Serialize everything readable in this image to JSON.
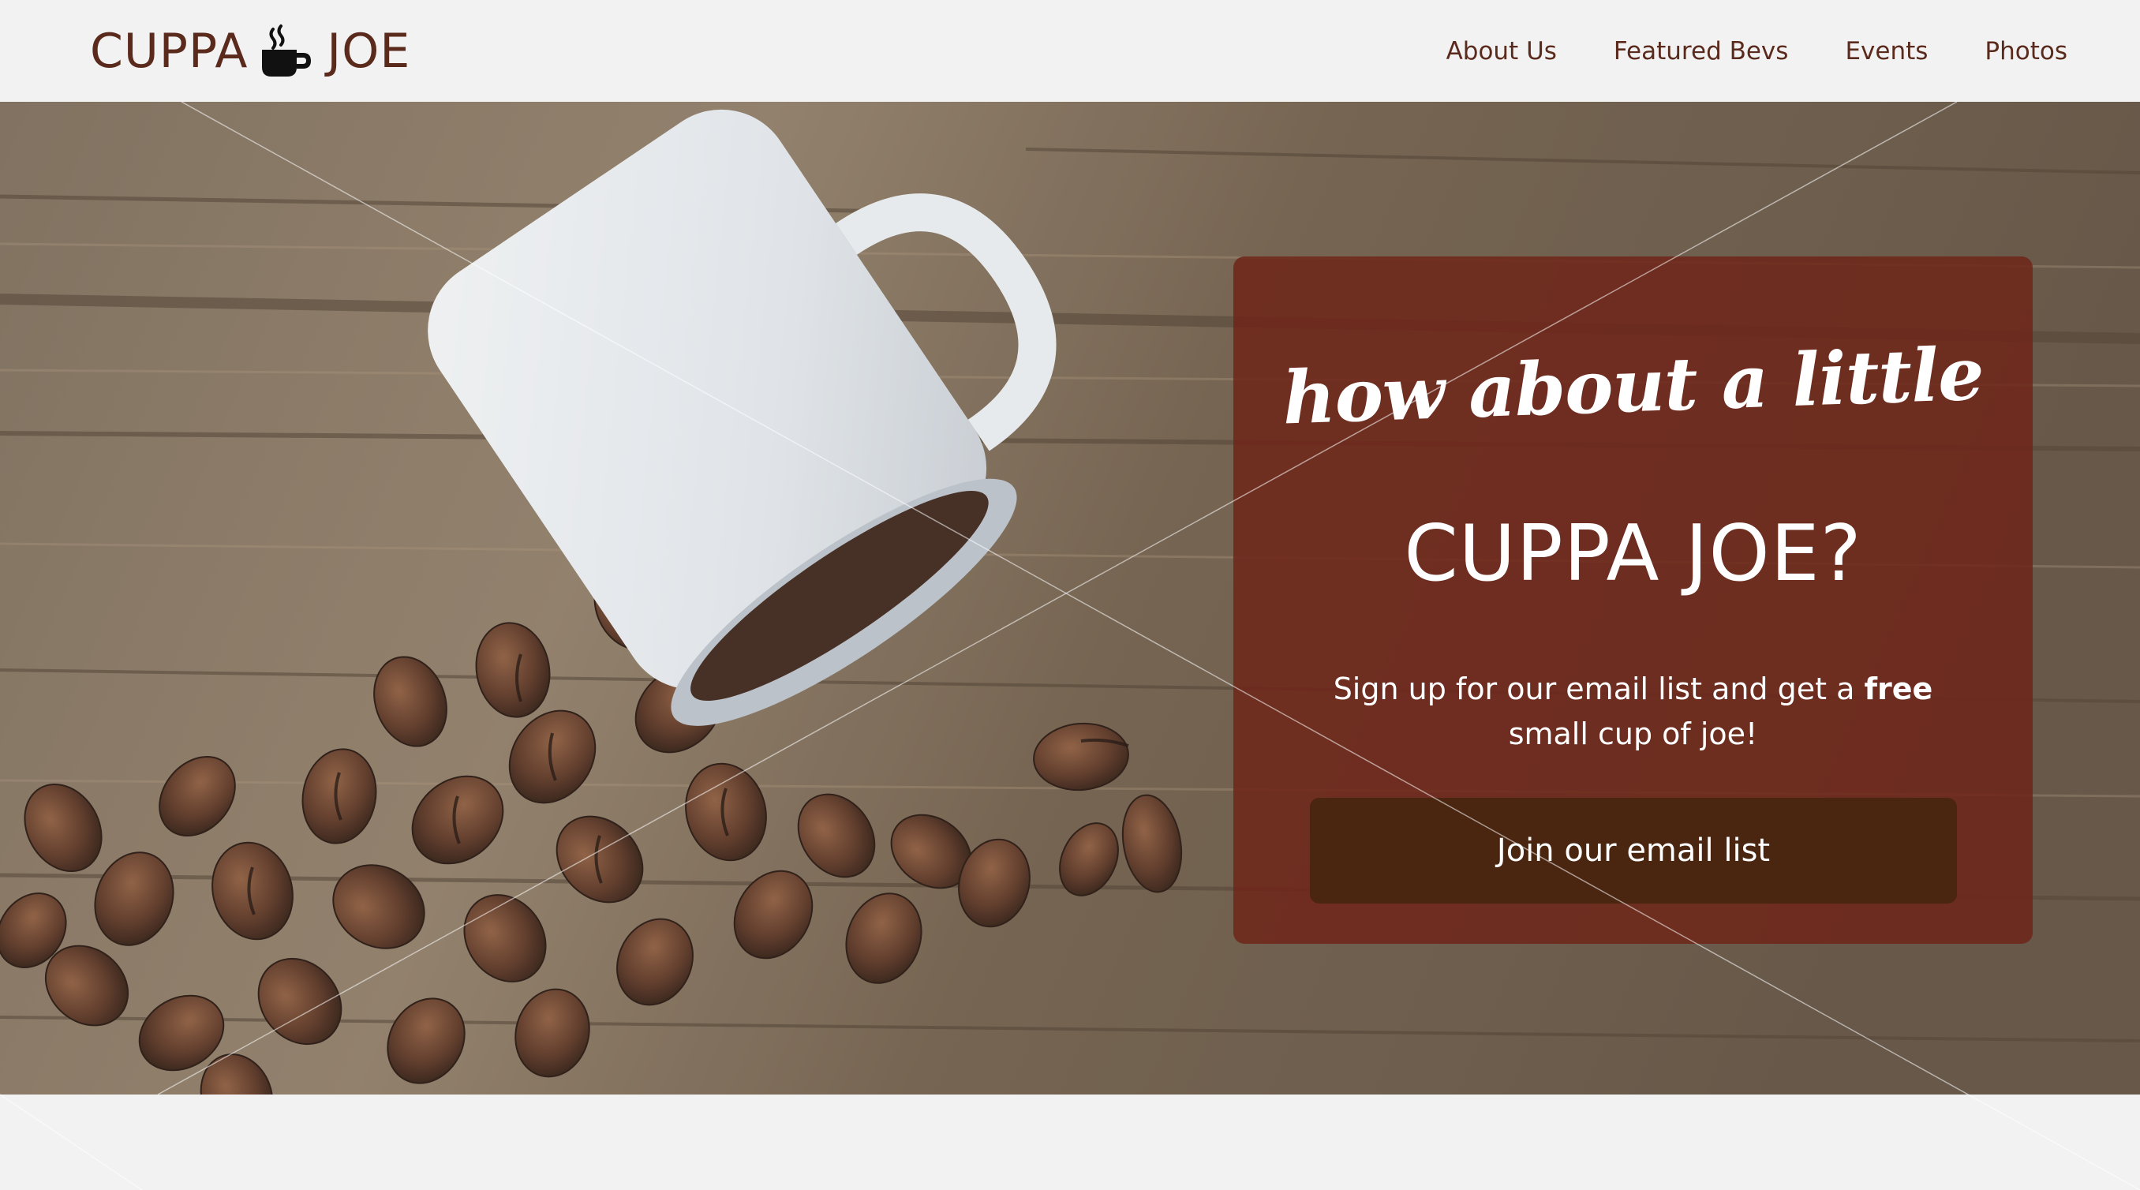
{
  "brand": {
    "name_left": "CUPPA",
    "name_right": "JOE",
    "icon": "coffee-mug-icon",
    "color": "#5a2a1c"
  },
  "nav": {
    "items": [
      {
        "label": "About Us"
      },
      {
        "label": "Featured Bevs"
      },
      {
        "label": "Events"
      },
      {
        "label": "Photos"
      }
    ]
  },
  "hero": {
    "image": "coffee-cup-and-beans-photo",
    "promo": {
      "tagline": "how about a little",
      "headline": "CUPPA JOE?",
      "offer_before": "Sign up for our email list and get a ",
      "offer_bold": "free",
      "offer_after": " small cup of joe!",
      "button_label": "Join our email list",
      "panel_color": "#6e2519",
      "button_color": "#4a2510"
    }
  }
}
